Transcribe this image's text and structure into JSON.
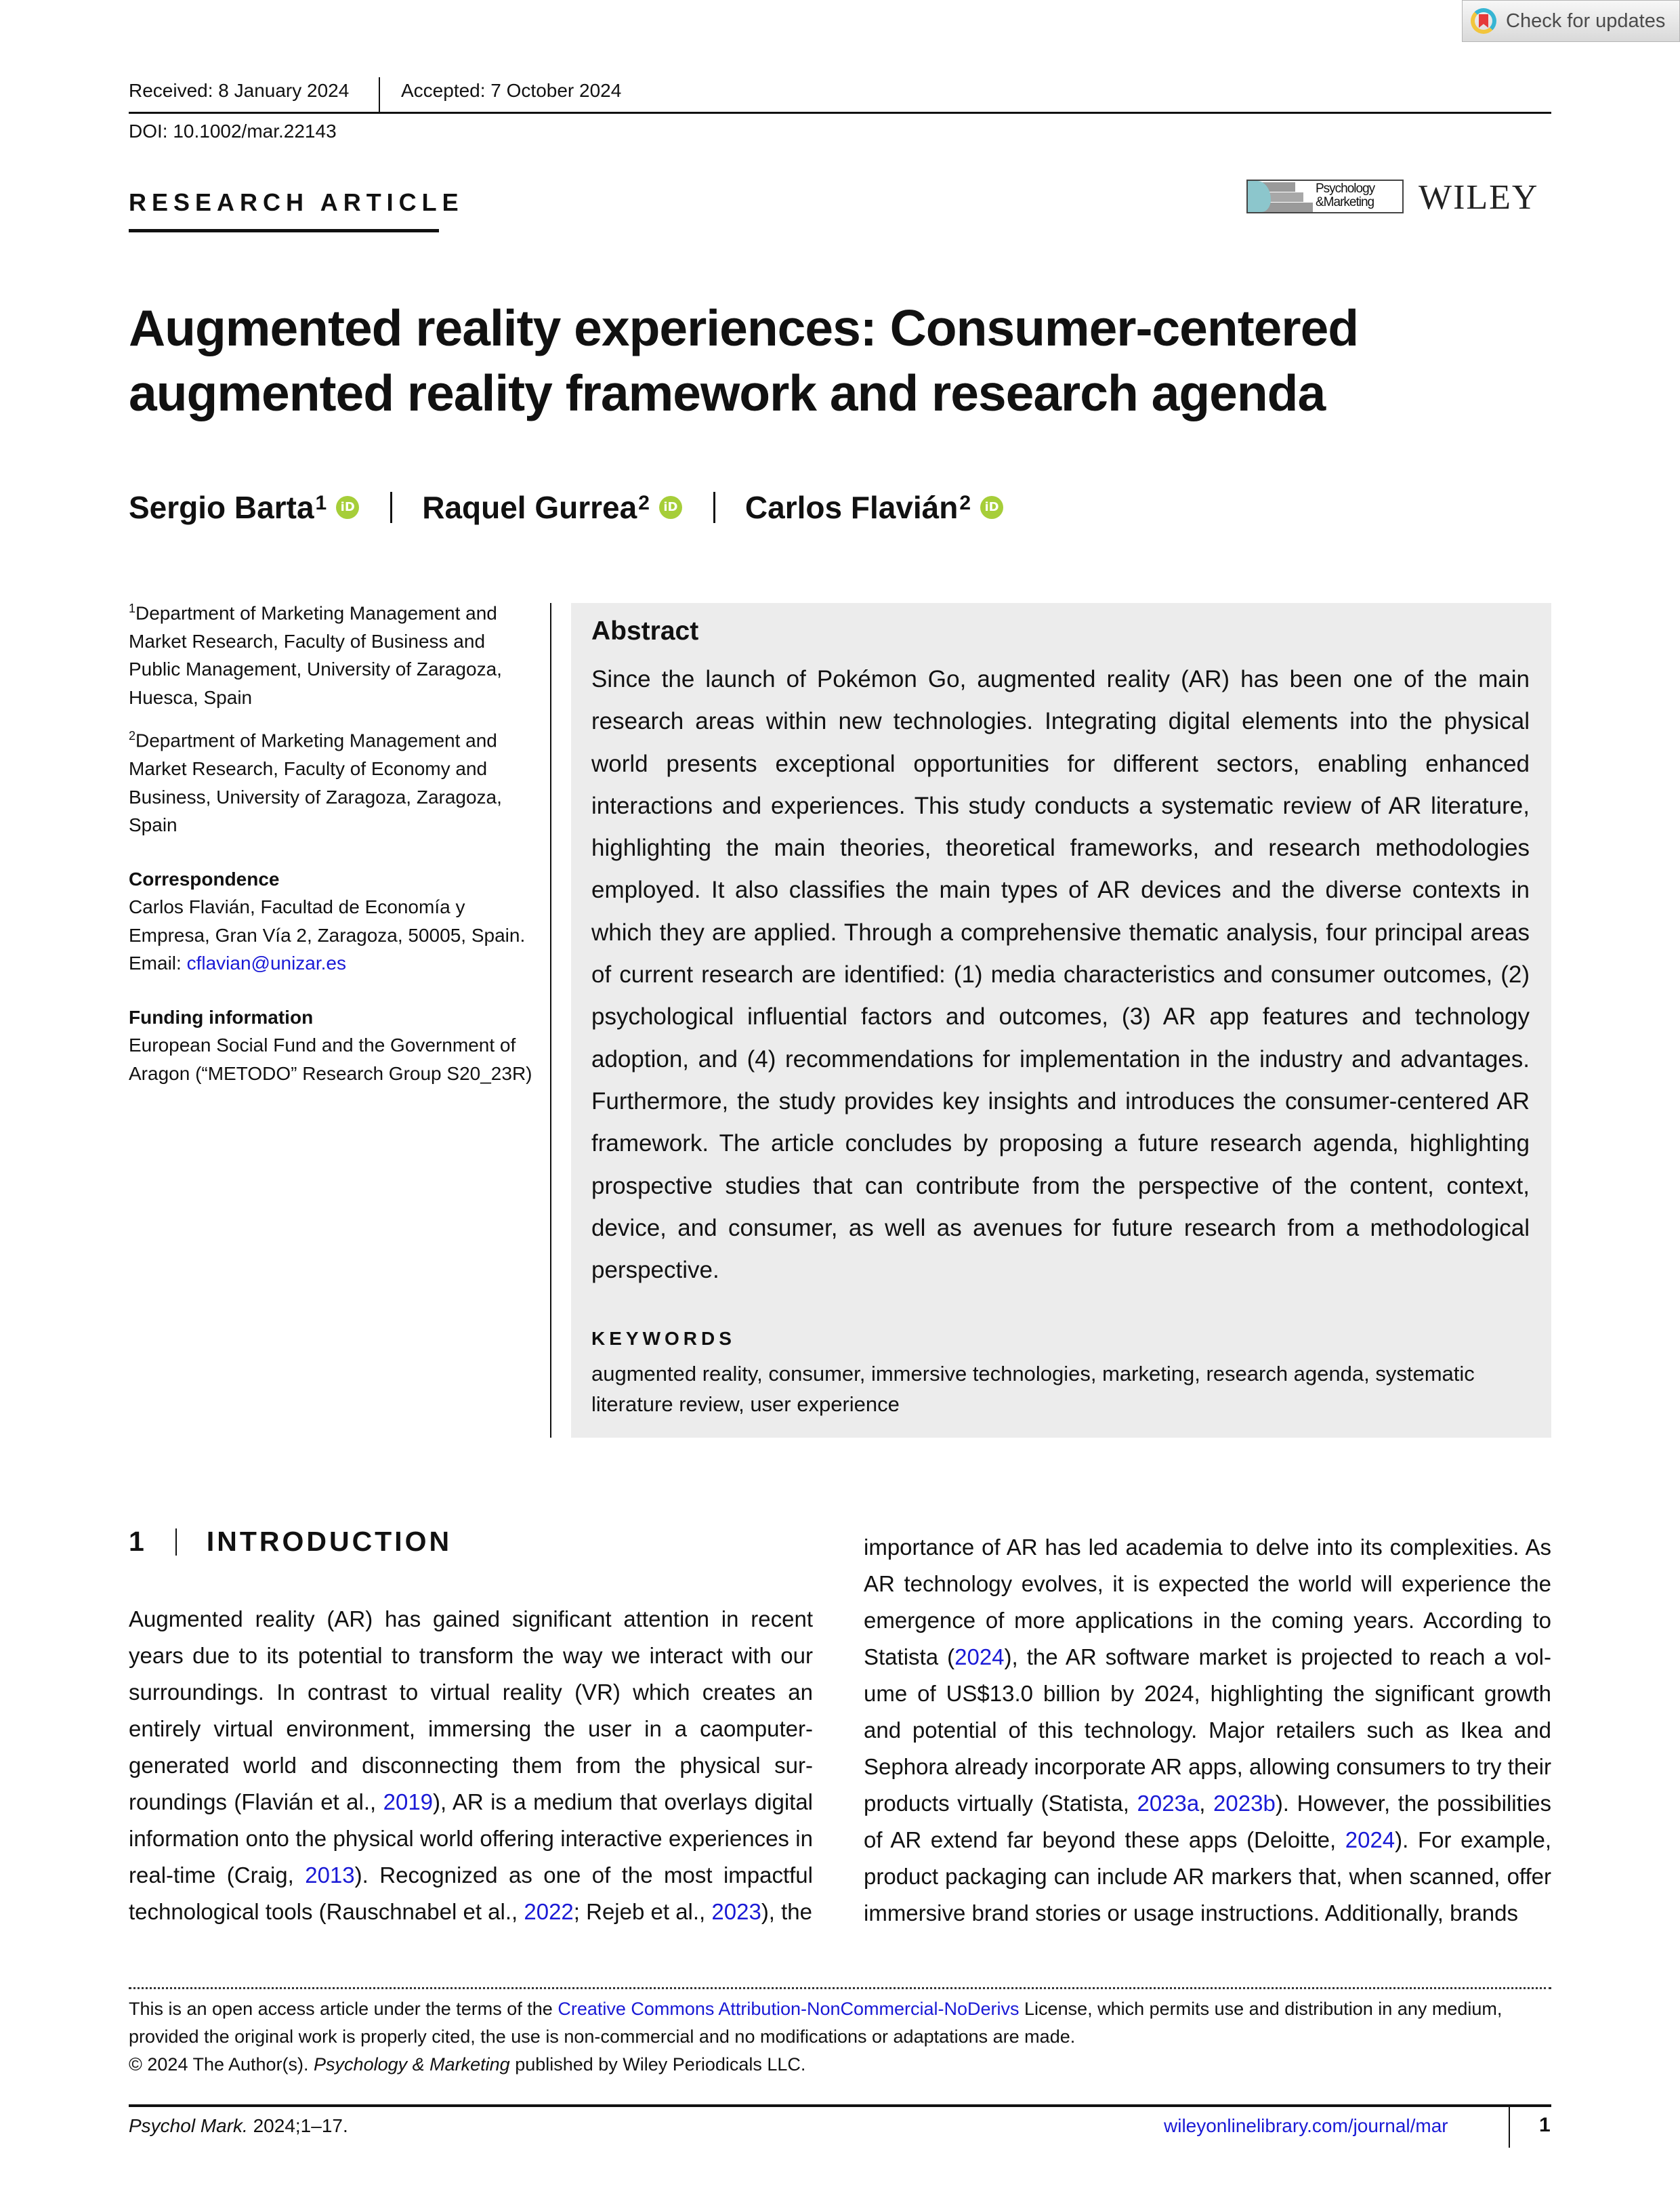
{
  "check_for_updates": {
    "label": "Check for updates",
    "icon": "crossmark-bookmark-icon"
  },
  "header": {
    "received": "Received: 8 January 2024",
    "accepted": "Accepted: 7 October 2024",
    "doi": "DOI: 10.1002/mar.22143",
    "article_type": "RESEARCH ARTICLE",
    "journal_logo_text_1": "Psychology",
    "journal_logo_text_2": "&Marketing",
    "publisher": "WILEY"
  },
  "title_line_1": "Augmented reality experiences: Consumer-centered",
  "title_line_2": "augmented reality framework and research agenda",
  "authors": [
    {
      "name": "Sergio Barta",
      "aff": "1",
      "orcid": "iD"
    },
    {
      "name": "Raquel Gurrea",
      "aff": "2",
      "orcid": "iD"
    },
    {
      "name": "Carlos Flavián",
      "aff": "2",
      "orcid": "iD"
    }
  ],
  "affiliations": [
    {
      "num": "1",
      "text": "Department of Marketing Management and Market Research, Faculty of Business and Public Management, University of Zaragoza, Huesca, Spain"
    },
    {
      "num": "2",
      "text": "Department of Marketing Management and Market Research, Faculty of Economy and Business, University of Zaragoza, Zaragoza, Spain"
    }
  ],
  "correspondence": {
    "heading": "Correspondence",
    "text": "Carlos Flavián, Facultad de Economía y Empresa, Gran Vía 2, Zaragoza, 50005, Spain.",
    "email_label": "Email: ",
    "email": "cflavian@unizar.es"
  },
  "funding": {
    "heading": "Funding information",
    "text": "European Social Fund and the Government of Aragon (“METODO” Research Group S20_23R)"
  },
  "abstract": {
    "heading": "Abstract",
    "text": "Since the launch of Pokémon Go, augmented reality (AR) has been one of the main research areas within new technologies. Integrating digital elements into the physical world presents exceptional opportunities for different sectors, enabling enhanced interactions and experiences. This study conducts a systematic review of AR liter­ature, highlighting the main theories, theoretical frameworks, and research meth­odologies employed. It also classifies the main types of AR devices and the diverse contexts in which they are applied. Through a comprehensive thematic analysis, four principal areas of current research are identified: (1) media characteristics and consumer outcomes, (2) psychological influential factors and outcomes, (3) AR app features and technology adoption, and (4) recommendations for implementation in the industry and advantages. Furthermore, the study provides key insights and introduces the consumer-centered AR framework. The article concludes by pro­posing a future research agenda, highlighting prospective studies that can contribute from the perspective of the content, context, device, and consumer, as well as avenues for future research from a methodological perspective.",
    "keywords_heading": "KEYWORDS",
    "keywords": "augmented reality, consumer, immersive technologies, marketing, research agenda, systematic literature review, user experience"
  },
  "introduction": {
    "number": "1",
    "heading": "INTRODUCTION",
    "col1": [
      {
        "t": "Augmented reality (AR) has gained significant attention in recent years due to its potential to transform the way we interact with our surroundings. In contrast to virtual reality (VR) which creates an entirely virtual environment, immersing the user in a caomputer-generated world and disconnecting them from the physical sur­roundings (Flavián et al., "
      },
      {
        "link": "2019"
      },
      {
        "t": "), AR is a medium that overlays digital information onto the physical world offering interactive experiences in real-time (Craig, "
      },
      {
        "link": "2013"
      },
      {
        "t": "). Recognized as one of the most impactful technological tools (Rauschnabel et al., "
      },
      {
        "link": "2022"
      },
      {
        "t": "; Rejeb et al., "
      },
      {
        "link": "2023"
      },
      {
        "t": "), the"
      }
    ],
    "col2": [
      {
        "t": "importance of AR has led academia to delve into its complexities. As AR technology evolves, it is expected the world will experience the emergence of more applications in the coming years. According to Statista ("
      },
      {
        "link": "2024"
      },
      {
        "t": "), the AR software market is projected to reach a vol­ume of US$13.0 billion by 2024, highlighting the significant growth and potential of this technology. Major retailers such as Ikea and Sephora already incorporate AR apps, allowing consumers to try their products virtually (Statista, "
      },
      {
        "link": "2023a"
      },
      {
        "t": ", "
      },
      {
        "link": "2023b"
      },
      {
        "t": "). However, the possibilities of AR extend far beyond these apps (Deloitte, "
      },
      {
        "link": "2024"
      },
      {
        "t": "). For example, product packaging can include AR markers that, when scanned, offer immersive brand stories or usage instructions. Additionally, brands"
      }
    ]
  },
  "license": {
    "pre": "This is an open access article under the terms of the ",
    "link": "Creative Commons Attribution-NonCommercial-NoDerivs",
    "post": " License, which permits use and distribution in any medium, provided the original work is properly cited, the use is non-commercial and no modifications or adaptations are made.",
    "copyright_pre": "© 2024 The Author(s). ",
    "copyright_journal": "Psychology & Marketing",
    "copyright_post": " published by Wiley Periodicals LLC."
  },
  "footer": {
    "journal_abbrev": "Psychol Mark.",
    "citation": " 2024;1–17.",
    "url": "wileyonlinelibrary.com/journal/mar",
    "page": "1"
  },
  "colors": {
    "link": "#1a1ad6",
    "abstract_bg": "#ececec",
    "orcid": "#a6ce39"
  }
}
